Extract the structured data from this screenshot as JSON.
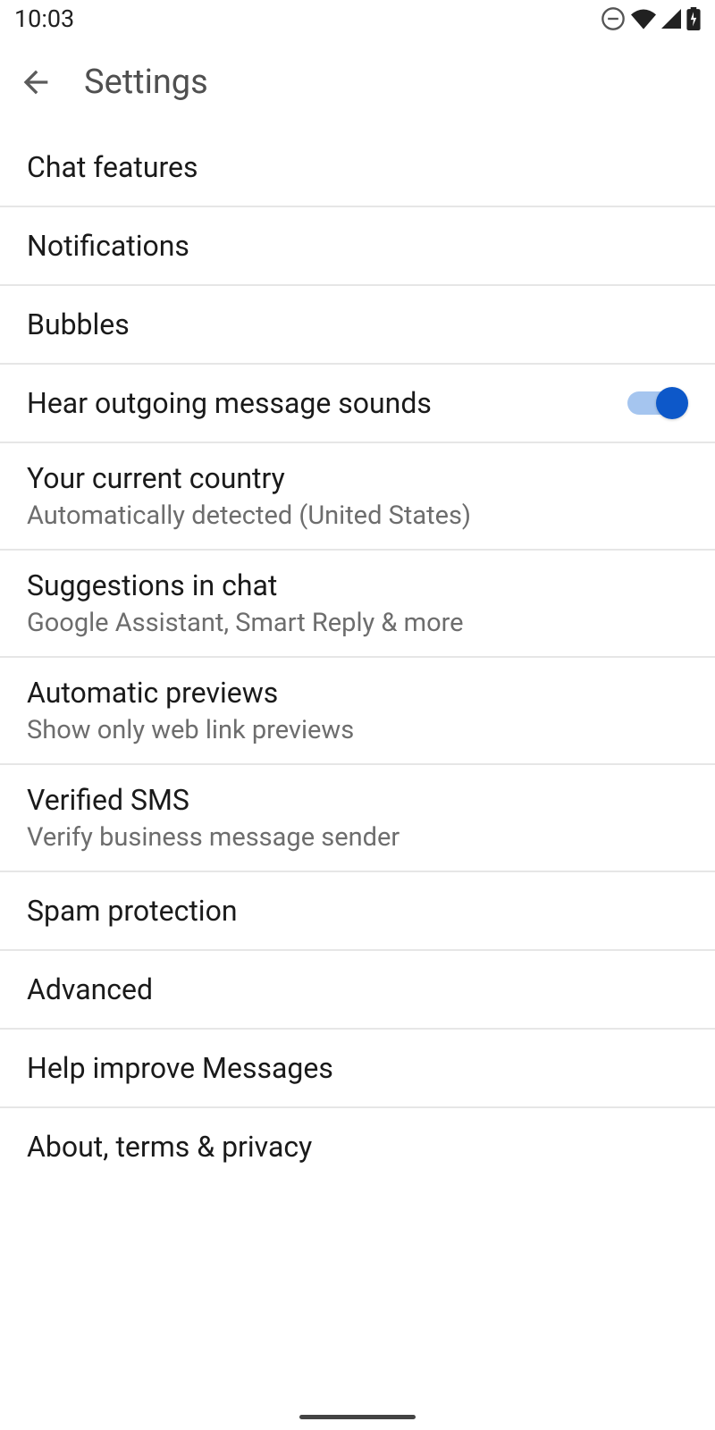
{
  "status": {
    "time": "10:03"
  },
  "header": {
    "title": "Settings"
  },
  "items": [
    {
      "title": "Chat features"
    },
    {
      "title": "Notifications"
    },
    {
      "title": "Bubbles"
    },
    {
      "title": "Hear outgoing message sounds",
      "toggle": true
    },
    {
      "title": "Your current country",
      "subtitle": "Automatically detected (United States)"
    },
    {
      "title": "Suggestions in chat",
      "subtitle": "Google Assistant, Smart Reply & more"
    },
    {
      "title": "Automatic previews",
      "subtitle": "Show only web link previews"
    },
    {
      "title": "Verified SMS",
      "subtitle": "Verify business message sender"
    },
    {
      "title": "Spam protection"
    },
    {
      "title": "Advanced"
    },
    {
      "title": "Help improve Messages"
    },
    {
      "title": "About, terms & privacy"
    }
  ]
}
